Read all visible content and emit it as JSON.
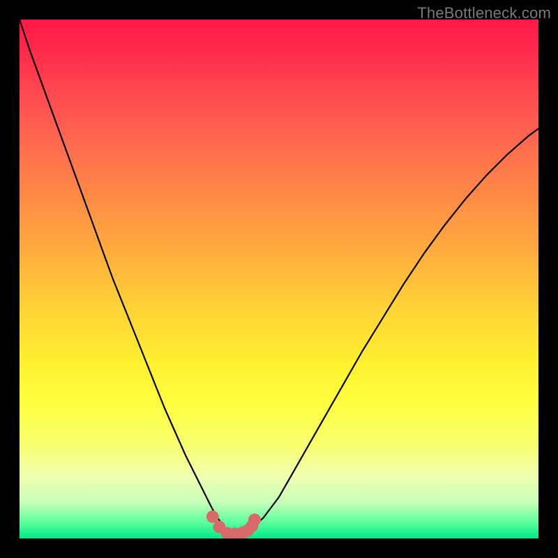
{
  "watermark": "TheBottleneck.com",
  "chart_data": {
    "type": "line",
    "title": "",
    "xlabel": "",
    "ylabel": "",
    "xlim": [
      0,
      100
    ],
    "ylim": [
      0,
      100
    ],
    "grid": false,
    "legend": false,
    "background": "vertical-gradient-red-to-green",
    "series": [
      {
        "name": "bottleneck-curve",
        "x": [
          0,
          2,
          4,
          6,
          8,
          10,
          12,
          14,
          16,
          18,
          20,
          22,
          24,
          26,
          28,
          30,
          32,
          34,
          36,
          37,
          38,
          39,
          40,
          41,
          42,
          43,
          44,
          45,
          47,
          50,
          54,
          58,
          62,
          66,
          70,
          74,
          78,
          82,
          86,
          90,
          94,
          98,
          100
        ],
        "y": [
          100,
          94,
          88.5,
          83,
          77.5,
          72,
          66.5,
          61,
          55.5,
          50,
          45,
          40,
          35,
          30,
          25,
          20.5,
          16,
          12,
          8,
          6,
          4.2,
          2.8,
          1.6,
          1.0,
          0.8,
          0.9,
          1.4,
          2.2,
          4,
          8,
          15,
          22,
          29,
          36,
          42.5,
          49,
          55,
          60.5,
          65.5,
          70,
          74,
          77.5,
          79
        ]
      },
      {
        "name": "optimal-zone-markers",
        "style": "dots",
        "color": "#d86a6a",
        "x": [
          37.2,
          38.5,
          40.0,
          41.5,
          43.0,
          44.0,
          44.8,
          45.3
        ],
        "y": [
          4.2,
          2.2,
          1.0,
          0.9,
          1.1,
          1.6,
          2.4,
          3.6
        ]
      }
    ]
  },
  "colors": {
    "curve": "#000000",
    "markers": "#d86a6a",
    "frame": "#000000"
  }
}
